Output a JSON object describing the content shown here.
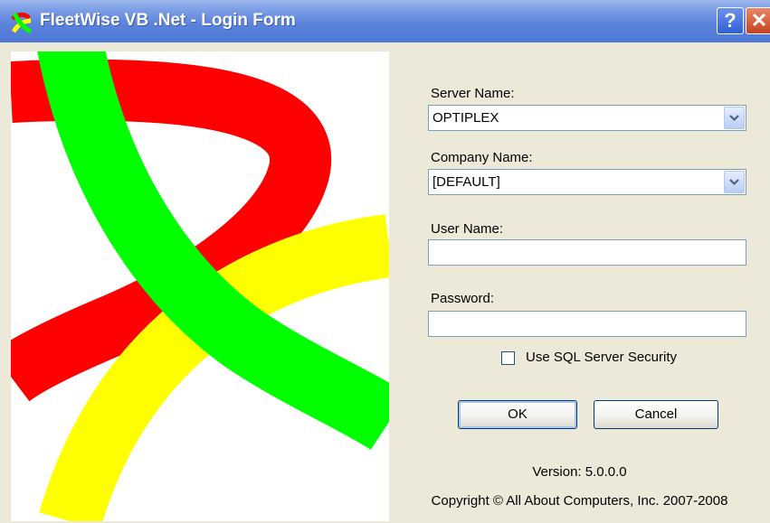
{
  "window": {
    "title": "FleetWise VB .Net - Login Form",
    "help_label": "?",
    "close_label": "✕"
  },
  "server": {
    "label": "Server Name:",
    "value": "OPTIPLEX"
  },
  "company": {
    "label": "Company Name:",
    "value": "[DEFAULT]"
  },
  "user": {
    "label": "User Name:",
    "value": ""
  },
  "password": {
    "label": "Password:",
    "value": ""
  },
  "sql_security": {
    "label": "Use SQL Server Security",
    "checked": false
  },
  "buttons": {
    "ok": "OK",
    "cancel": "Cancel"
  },
  "footer": {
    "version": "Version:  5.0.0.0",
    "copyright": "Copyright © All About Computers, Inc. 2007-2008"
  },
  "colors": {
    "red": "#ff0000",
    "green": "#00ff00",
    "yellow": "#ffff00",
    "titlebar": "#4d77d4"
  },
  "icons": {
    "app": "fleetwise-logo-icon",
    "dropdown": "chevron-down-icon"
  }
}
